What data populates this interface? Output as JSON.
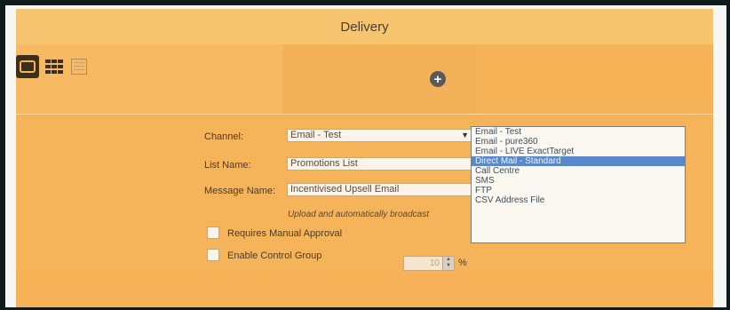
{
  "header": {
    "title": "Delivery"
  },
  "toolbar": {
    "views": [
      {
        "name": "card-view",
        "icon": "card-view-icon",
        "active": true
      },
      {
        "name": "grid-view",
        "icon": "grid-view-icon",
        "active": false
      },
      {
        "name": "list-view",
        "icon": "list-view-icon",
        "active": false
      }
    ],
    "add_icon": "plus-circle-icon"
  },
  "form": {
    "channel_label": "Channel:",
    "channel_value": "Email - Test",
    "list_name_label": "List Name:",
    "list_name_value": "Promotions List",
    "message_name_label": "Message Name:",
    "message_name_value": "Incentivised Upsell Email",
    "hint": "Upload and automatically broadcast",
    "requires_approval_label": "Requires Manual Approval",
    "enable_control_label": "Enable Control Group",
    "control_pct_value": "10",
    "pct_symbol": "%"
  },
  "channel_options": [
    "Email - Test",
    "Email - pure360",
    "Email - LIVE ExactTarget",
    "Direct Mail - Standard",
    "Call Centre",
    "SMS",
    "FTP",
    "CSV Address File"
  ],
  "selected_option_index": 3,
  "colors": {
    "panel": "#f6b45a",
    "header": "#f7c46f",
    "selected": "#5a88c8"
  }
}
